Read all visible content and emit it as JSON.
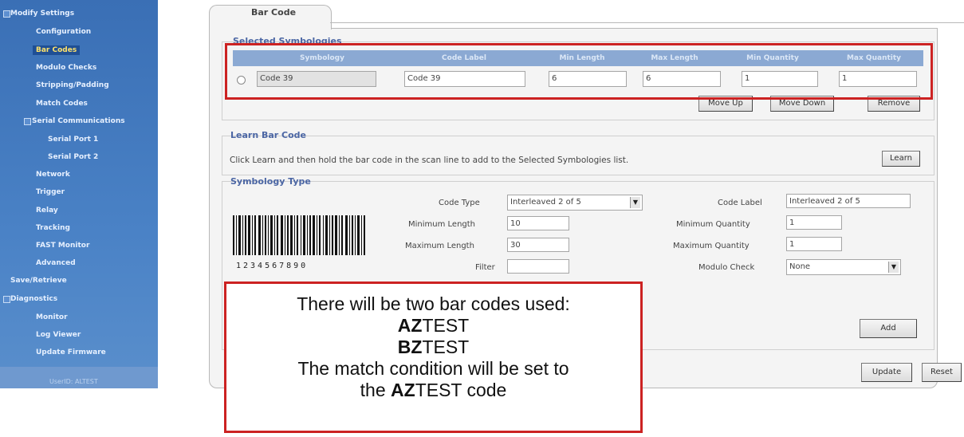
{
  "sidebar": {
    "items": [
      {
        "label": "Modify Settings"
      },
      {
        "label": "Configuration"
      },
      {
        "label": "Bar Codes"
      },
      {
        "label": "Modulo Checks"
      },
      {
        "label": "Stripping/Padding"
      },
      {
        "label": "Match Codes"
      },
      {
        "label": "Serial Communications"
      },
      {
        "label": "Serial Port 1"
      },
      {
        "label": "Serial Port 2"
      },
      {
        "label": "Network"
      },
      {
        "label": "Trigger"
      },
      {
        "label": "Relay"
      },
      {
        "label": "Tracking"
      },
      {
        "label": "FAST Monitor"
      },
      {
        "label": "Advanced"
      },
      {
        "label": "Save/Retrieve"
      },
      {
        "label": "Diagnostics"
      },
      {
        "label": "Monitor"
      },
      {
        "label": "Log Viewer"
      },
      {
        "label": "Update Firmware"
      }
    ],
    "user": "UserID: ALTEST"
  },
  "tab": {
    "label": "Bar Code"
  },
  "selected": {
    "title": "Selected Symbologies",
    "headers": [
      "Symbology",
      "Code Label",
      "Min Length",
      "Max Length",
      "Min Quantity",
      "Max Quantity"
    ],
    "row": {
      "symbology": "Code 39",
      "code_label": "Code 39",
      "min_length": "6",
      "max_length": "6",
      "min_quantity": "1",
      "max_quantity": "1"
    },
    "buttons": {
      "move_up": "Move Up",
      "move_down": "Move Down",
      "remove": "Remove"
    }
  },
  "learn": {
    "title": "Learn Bar Code",
    "text": "Click Learn and then hold the bar code in the scan line to add to the Selected Symbologies list.",
    "button": "Learn"
  },
  "symbology_type": {
    "title": "Symbology Type",
    "code_type_label": "Code Type",
    "code_type_value": "Interleaved 2 of 5",
    "min_length_label": "Minimum Length",
    "min_length_value": "10",
    "max_length_label": "Maximum Length",
    "max_length_value": "30",
    "filter_label": "Filter",
    "filter_value": "",
    "code_label_label": "Code Label",
    "code_label_value": "Interleaved 2 of 5",
    "min_qty_label": "Minimum Quantity",
    "min_qty_value": "1",
    "max_qty_label": "Maximum Quantity",
    "max_qty_value": "1",
    "modulo_label": "Modulo Check",
    "modulo_value": "None",
    "add_button": "Add",
    "barcode_digits": "1234567890"
  },
  "footer": {
    "update": "Update",
    "reset": "Reset"
  },
  "callout": {
    "line1": "There will be two bar codes used:",
    "code1_bold": "AZ",
    "code1_rest": "TEST",
    "code2_bold": "BZ",
    "code2_rest": "TEST",
    "line4": "The match condition will be set to",
    "line5_pre": "the ",
    "line5_bold": "AZ",
    "line5_post": "TEST code"
  }
}
